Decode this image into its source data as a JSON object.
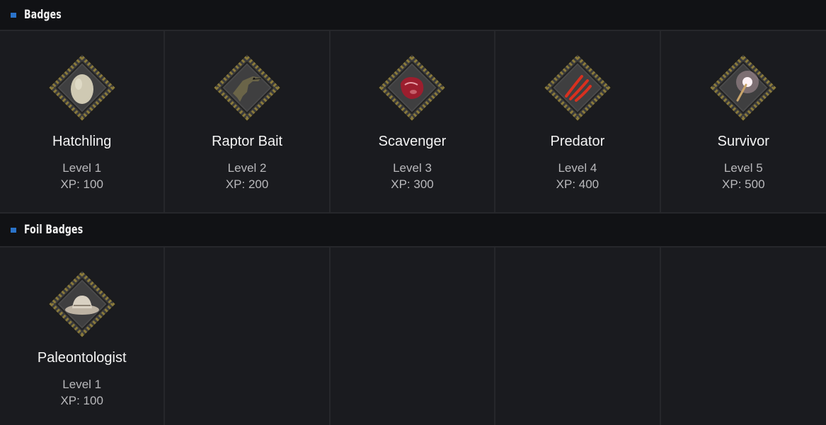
{
  "sections": [
    {
      "title": "Badges",
      "badges": [
        {
          "name": "Hatchling",
          "level": "Level 1",
          "xp": "XP: 100",
          "icon": "egg-icon"
        },
        {
          "name": "Raptor Bait",
          "level": "Level 2",
          "xp": "XP: 200",
          "icon": "raptor-icon"
        },
        {
          "name": "Scavenger",
          "level": "Level 3",
          "xp": "XP: 300",
          "icon": "meat-icon"
        },
        {
          "name": "Predator",
          "level": "Level 4",
          "xp": "XP: 400",
          "icon": "claw-marks-icon"
        },
        {
          "name": "Survivor",
          "level": "Level 5",
          "xp": "XP: 500",
          "icon": "flare-icon"
        }
      ]
    },
    {
      "title": "Foil Badges",
      "badges": [
        {
          "name": "Paleontologist",
          "level": "Level 1",
          "xp": "XP: 100",
          "icon": "hat-icon"
        }
      ]
    }
  ],
  "colors": {
    "accent": "#2a73c9",
    "background": "#1a1b1f",
    "header_bg": "#111215",
    "frame_gold": "#8a7a3a"
  }
}
